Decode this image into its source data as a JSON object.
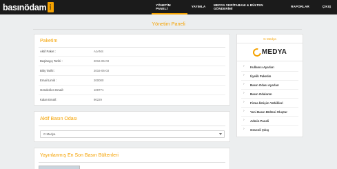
{
  "header": {
    "logo_text": "basınödam",
    "logo_badge": "ANKA",
    "nav": [
      {
        "label": "YÖNETİM PANELİ",
        "active": true
      },
      {
        "label": "YAYIMLA",
        "active": false
      },
      {
        "label": "MEDYA VERİTABANI & BÜLTEN GÖNDERİMİ",
        "active": false
      },
      {
        "label": "RAPORLAR",
        "active": false
      },
      {
        "label": "ÇIKIŞ",
        "active": false
      }
    ],
    "accent_color": "#f5a200"
  },
  "page_title": "Yönetim Paneli",
  "package": {
    "heading": "Paketim",
    "rows": [
      {
        "label": "Aktif Paket :",
        "value": "AJANS"
      },
      {
        "label": "Başlangıç Tarihi :",
        "value": "2016-06-03"
      },
      {
        "label": "Bitiş Tarihi :",
        "value": "2016-06-03"
      },
      {
        "label": "Email Limiti :",
        "value": "200000"
      },
      {
        "label": "Gönderilen Email :",
        "value": "109771"
      },
      {
        "label": "Kalan Email :",
        "value": "90229"
      }
    ]
  },
  "active_room": {
    "heading": "Aktif Basın Odası",
    "select_value": "G Medya"
  },
  "latest": {
    "heading": "Yayınlanmış En Son Basın Bültenleri"
  },
  "sidebar": {
    "title": "G Medya",
    "brand_text": "MEDYA",
    "items": [
      {
        "label": "Kullanıcı Ayarları"
      },
      {
        "label": "Üyelik Paketim"
      },
      {
        "label": "Basın Odası Ayarları"
      },
      {
        "label": "Basın Odalarım"
      },
      {
        "label": "Firma İletişim Yetkilileri"
      },
      {
        "label": "Yeni Basın Bülteni Oluştur"
      },
      {
        "label": "Admin Paneli"
      },
      {
        "label": "Güvenli Çıkış"
      }
    ]
  }
}
